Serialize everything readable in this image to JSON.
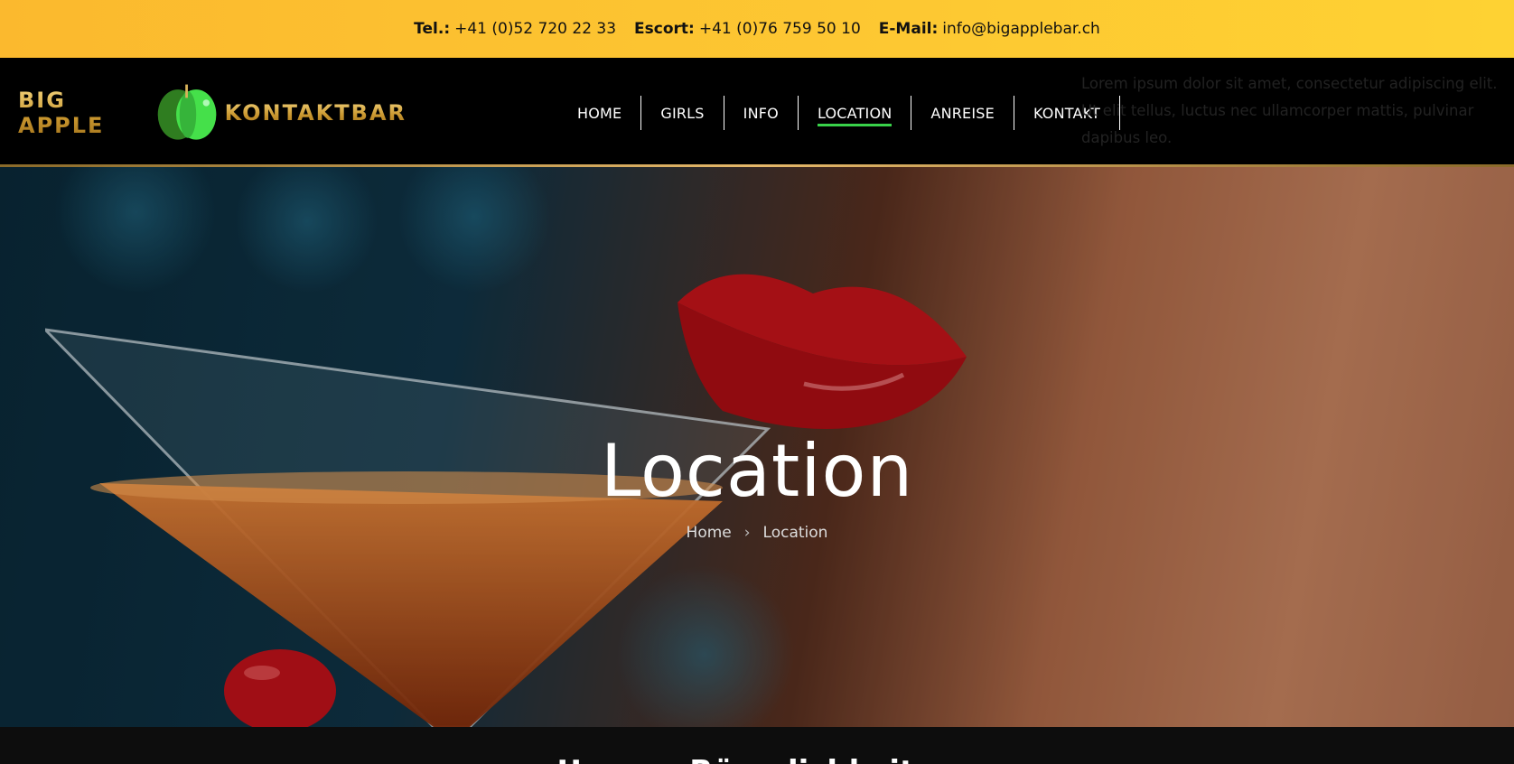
{
  "topbar": {
    "tel_label": "Tel.:",
    "tel_value": "+41 (0)52 720 22 33",
    "escort_label": "Escort:",
    "escort_value": "+41 (0)76 759 50 10",
    "email_label": "E-Mail:",
    "email_value": "info@bigapplebar.ch",
    "bg_color": "#fdc832"
  },
  "logo": {
    "word_left": "BIG  APPLE",
    "word_right": "KONTAKTBAR"
  },
  "nav": {
    "items": [
      {
        "label": "HOME"
      },
      {
        "label": "GIRLS"
      },
      {
        "label": "INFO"
      },
      {
        "label": "LOCATION",
        "active": true
      },
      {
        "label": "ANREISE"
      },
      {
        "label": "KONTAKT"
      }
    ],
    "active_color": "#39d24a"
  },
  "ghost_text": "Lorem ipsum dolor sit amet, consectetur adipiscing elit. Ut elit tellus, luctus nec ullamcorper mattis, pulvinar dapibus leo.",
  "hero": {
    "title": "Location",
    "breadcrumb_home": "Home",
    "breadcrumb_sep": "›",
    "breadcrumb_current": "Location"
  },
  "section": {
    "heading": "Unsere Räumlichkeiten"
  }
}
